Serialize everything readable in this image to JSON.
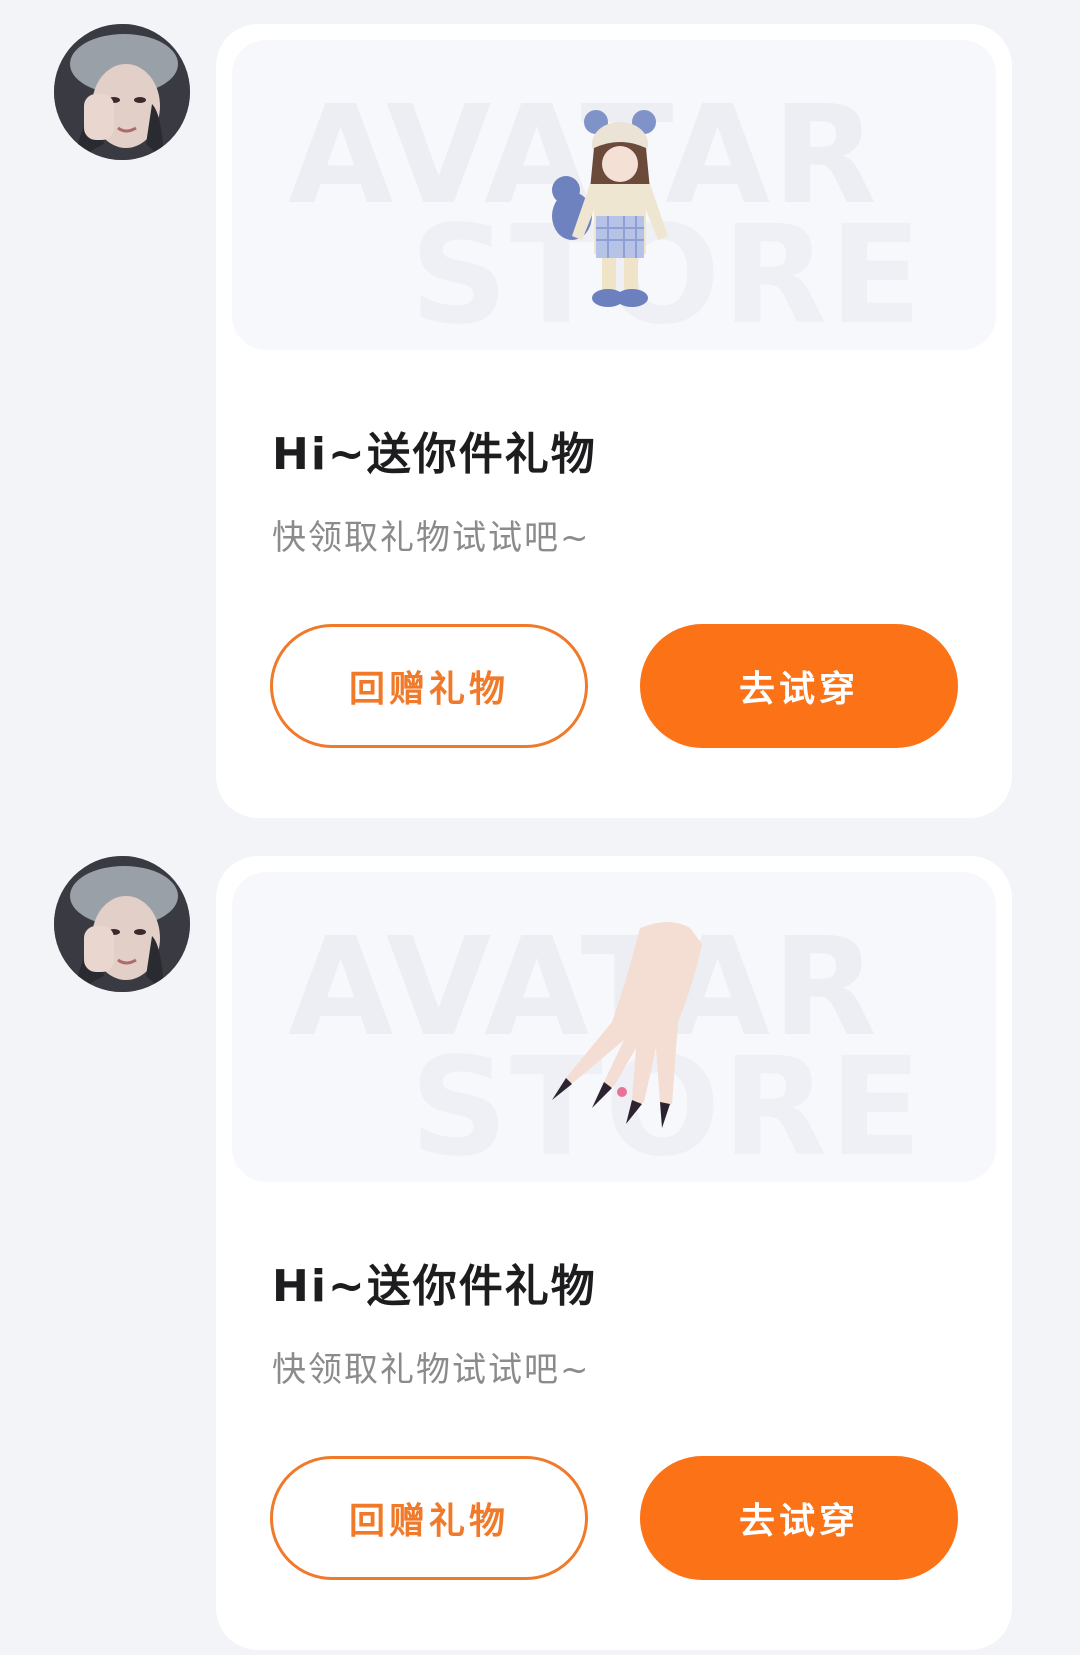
{
  "messages": [
    {
      "sender_avatar": "user-avatar",
      "watermark_top": "AVATAR",
      "watermark_bottom": "STORE",
      "item_icon": "doll-outfit-icon",
      "title": "Hi~送你件礼物",
      "subtitle": "快领取礼物试试吧~",
      "return_gift_label": "回赠礼物",
      "try_on_label": "去试穿"
    },
    {
      "sender_avatar": "user-avatar",
      "watermark_top": "AVATAR",
      "watermark_bottom": "STORE",
      "item_icon": "hand-nails-icon",
      "title": "Hi~送你件礼物",
      "subtitle": "快领取礼物试试吧~",
      "return_gift_label": "回赠礼物",
      "try_on_label": "去试穿"
    }
  ],
  "colors": {
    "accent": "#fb7316",
    "outline": "#f07a2a",
    "background": "#f3f4f8",
    "card": "#ffffff"
  }
}
